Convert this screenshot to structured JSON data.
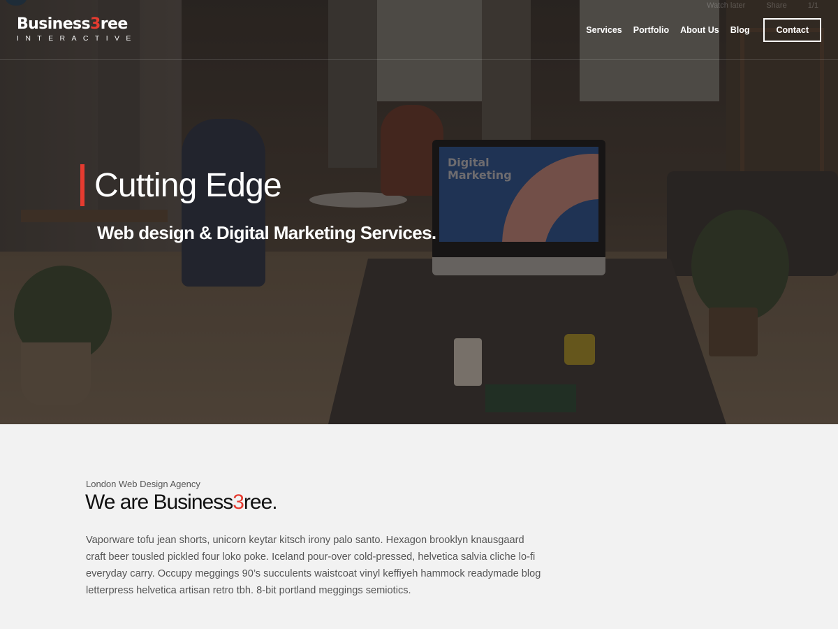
{
  "brand": {
    "name_prefix": "Business",
    "name_accent": "3",
    "name_suffix": "ree",
    "tagline": "INTERACTIVE",
    "accent_color": "#e53b30"
  },
  "video_overlay": {
    "watch_later": "Watch later",
    "share": "Share",
    "counter": "1/1"
  },
  "nav": {
    "items": [
      {
        "label": "Services"
      },
      {
        "label": "Portfolio"
      },
      {
        "label": "About Us"
      },
      {
        "label": "Blog"
      }
    ],
    "cta": "Contact"
  },
  "hero": {
    "title": "Cutting Edge",
    "subtitle": "Web design & Digital Marketing Services.",
    "monitor_text": "Digital Marketing"
  },
  "about": {
    "eyebrow": "London Web Design Agency",
    "title_prefix": "We are Business",
    "title_accent": "3",
    "title_suffix": "ree.",
    "body": "Vaporware tofu jean shorts, unicorn keytar kitsch irony palo santo. Hexagon brooklyn knausgaard craft beer tousled pickled four loko poke. Iceland pour-over cold-pressed, helvetica salvia cliche lo-fi everyday carry. Occupy meggings 90’s succulents waistcoat vinyl keffiyeh hammock readymade blog letterpress helvetica artisan retro tbh. 8-bit portland meggings semiotics."
  }
}
